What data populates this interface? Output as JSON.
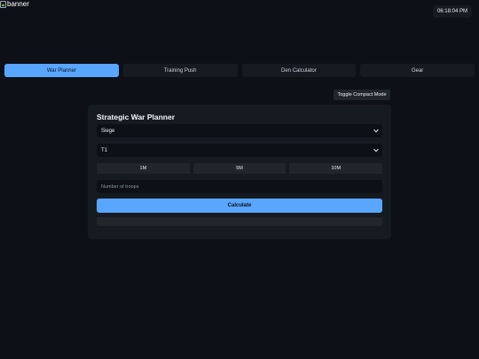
{
  "banner": {
    "alt_text": "banner"
  },
  "clock": {
    "time": "06:18:04 PM"
  },
  "tabs": [
    {
      "label": "War Planner",
      "active": true
    },
    {
      "label": "Training Push",
      "active": false
    },
    {
      "label": "Den Calculator",
      "active": false
    },
    {
      "label": "Gear",
      "active": false
    }
  ],
  "toolbar": {
    "compact_label": "Toggle Compact Mode"
  },
  "planner": {
    "title": "Strategic War Planner",
    "unit_select": "Siege",
    "tier_select": "T1",
    "quick_amounts": [
      "1M",
      "5M",
      "10M"
    ],
    "troops_placeholder": "Number of troops",
    "calculate_label": "Calculate"
  },
  "colors": {
    "accent": "#58a6ff",
    "background": "#0d1117",
    "panel": "#161b22"
  }
}
